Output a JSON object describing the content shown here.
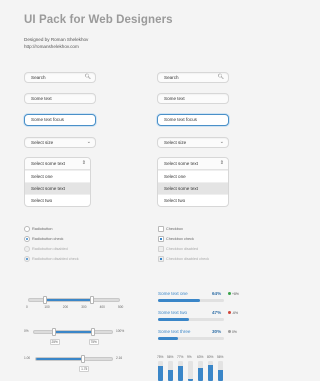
{
  "header": {
    "title": "UI Pack for Web Designers",
    "designed_by": "Designed by Roman Shelekhov",
    "url": "http://romanshelekhov.com"
  },
  "inputs": {
    "search_placeholder": "Search",
    "some_text": "Some text",
    "some_text_focus": "Some text focus",
    "select_size": "Select size",
    "select_some_text": "Select some text"
  },
  "select_options": [
    "Select one",
    "Select some text",
    "Select two"
  ],
  "radios": {
    "items": [
      "Radiobutton",
      "Radiobutton check",
      "Radiobutton disabled",
      "Radiobutton disabled check"
    ]
  },
  "checkboxes": {
    "items": [
      "Checkbox",
      "Checkbox check",
      "Checkbox disabled",
      "Checkbox disabled check"
    ]
  },
  "slider1": {
    "ticks": [
      "0",
      "100",
      "200",
      "300",
      "400",
      "500"
    ],
    "low": 0.18,
    "high": 0.7
  },
  "slider2": {
    "min_label": "0%",
    "max_label": "100%",
    "tip_low": "25%",
    "tip_high": "75%",
    "low": 0.25,
    "high": 0.75
  },
  "slider3": {
    "min_label": "1.00",
    "max_label": "2.16",
    "tip": "1.75",
    "value": 0.62
  },
  "progress": [
    {
      "label": "Some text one",
      "pct": "64%",
      "pct_value": 0.64,
      "delta": "+8%",
      "delta_color": "#3aa34a"
    },
    {
      "label": "Some text two",
      "pct": "47%",
      "pct_value": 0.47,
      "delta": "-6%",
      "delta_color": "#d0463b"
    },
    {
      "label": "Some text three",
      "pct": "30%",
      "pct_value": 0.3,
      "delta": "0%",
      "delta_color": "#a0a0a0"
    }
  ],
  "vbars": {
    "labels": [
      "75%",
      "56%",
      "77%",
      "9%",
      "63%",
      "80%",
      "56%"
    ],
    "values": [
      0.75,
      0.56,
      0.77,
      0.09,
      0.63,
      0.8,
      0.56
    ]
  },
  "colors": {
    "accent": "#3a86c8",
    "focus_border": "#4a90c8"
  }
}
